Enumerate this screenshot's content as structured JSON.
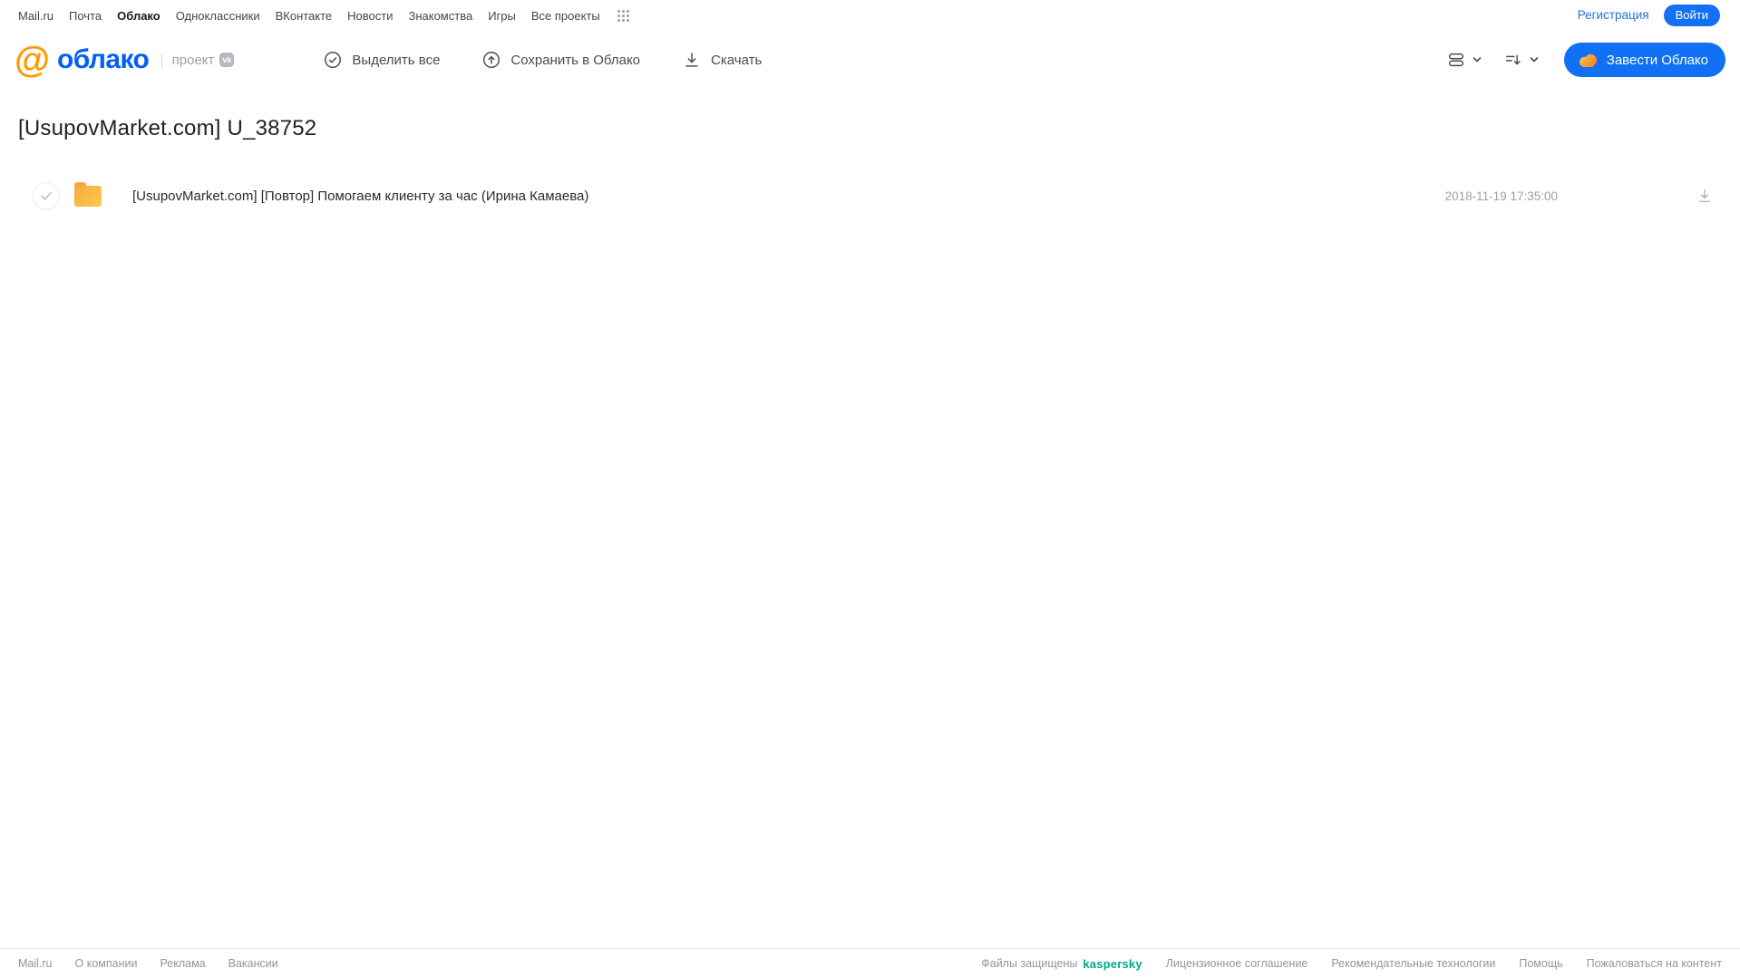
{
  "topnav": {
    "items": [
      "Mail.ru",
      "Почта",
      "Облако",
      "Одноклассники",
      "ВКонтакте",
      "Новости",
      "Знакомства",
      "Игры",
      "Все проекты"
    ],
    "registration": "Регистрация",
    "login": "Войти"
  },
  "header": {
    "logo": {
      "at": "@",
      "name": "облако",
      "divider": "|",
      "project": "проект",
      "vk": "vk"
    },
    "toolbar": {
      "select_all": "Выделить все",
      "save_to_cloud": "Сохранить в Облако",
      "download": "Скачать"
    },
    "create_cloud": "Завести Облако"
  },
  "main": {
    "title": "[UsupovMarket.com] U_38752",
    "files": [
      {
        "type": "folder",
        "name": "[UsupovMarket.com] [Повтор] Помогаем клиенту за час (Ирина Камаева)",
        "date": "2018-11-19 17:35:00"
      }
    ]
  },
  "footer": {
    "links_left": [
      "Mail.ru",
      "О компании",
      "Реклама",
      "Вакансии"
    ],
    "protected_text": "Файлы защищены",
    "kaspersky": "kaspersky",
    "links_right": [
      "Лицензионное соглашение",
      "Рекомендательные технологии",
      "Помощь",
      "Пожаловаться на контент"
    ]
  },
  "colors": {
    "brand_blue": "#005ff9",
    "button_blue": "#1170f4",
    "logo_orange": "#ff9900",
    "folder_yellow": "#fbc54f",
    "kaspersky_green": "#00a88e",
    "muted_gray": "#9aa0a6"
  }
}
